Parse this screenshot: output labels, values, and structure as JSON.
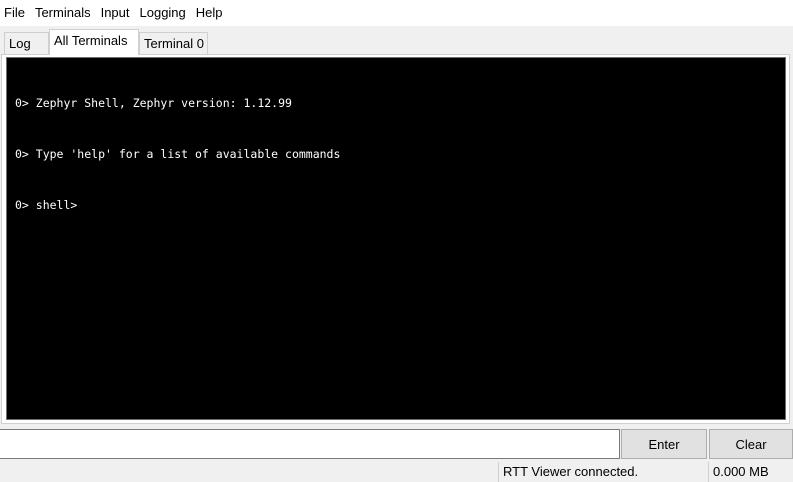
{
  "menu": {
    "items": [
      "File",
      "Terminals",
      "Input",
      "Logging",
      "Help"
    ]
  },
  "tabs": [
    {
      "label": "Log",
      "active": false
    },
    {
      "label": "All Terminals",
      "active": true
    },
    {
      "label": "Terminal 0",
      "active": false
    }
  ],
  "terminal": {
    "lines": [
      "0> Zephyr Shell, Zephyr version: 1.12.99",
      "0> Type 'help' for a list of available commands",
      "0> shell>"
    ],
    "background": "#000000",
    "foreground": "#ffffff"
  },
  "input": {
    "value": "",
    "placeholder": ""
  },
  "buttons": {
    "enter_label": "Enter",
    "clear_label": "Clear"
  },
  "status": {
    "connection": "RTT Viewer connected.",
    "data_size": "0.000 MB"
  }
}
